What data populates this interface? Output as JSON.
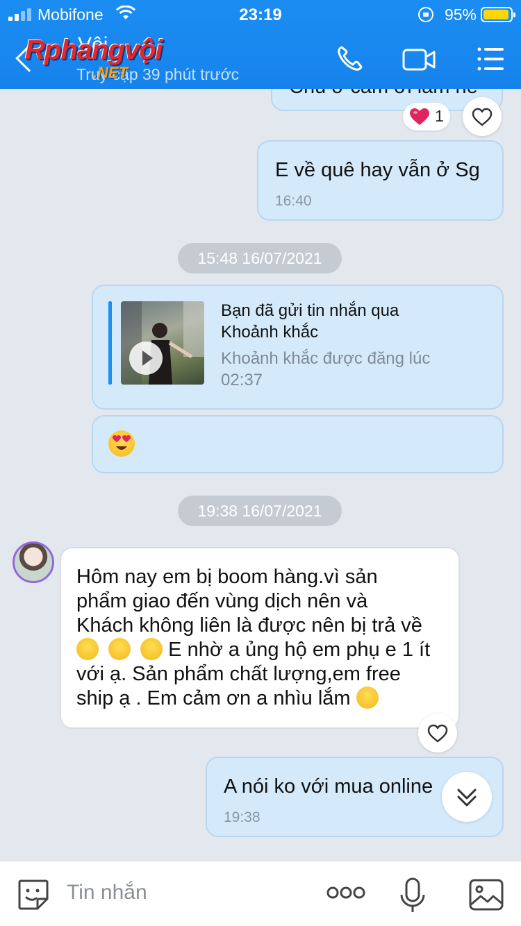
{
  "status_bar": {
    "carrier": "Mobifone",
    "time": "23:19",
    "battery": "95%",
    "battery_level": 0.95
  },
  "header": {
    "contact_name": "Vội",
    "subtitle": "Truy cập 39 phút trước",
    "watermark": "Rphangvội",
    "watermark_suffix": ".NET"
  },
  "messages": {
    "partial_text": "Chủ ơ cảm ơi lắm ne",
    "reaction_count": "1",
    "out_1": {
      "text": "E về quê hay vẫn ở Sg",
      "time": "16:40"
    },
    "separator_1": "15:48 16/07/2021",
    "quote": {
      "title_line1": "Bạn đã gửi tin nhắn qua",
      "title_line2": "Khoảnh khắc",
      "sub_line1": "Khoảnh khắc được đăng lúc",
      "sub_line2": "02:37"
    },
    "separator_2": "19:38 16/07/2021",
    "in_1": {
      "line1": "Hôm nay em bị boom hàng.vì sản",
      "line2": "phẩm giao đến vùng dịch nên và",
      "line3": "Khách không liên là được nên bị trả về",
      "line4": " E nhờ a ủng hộ em phụ e 1 ít",
      "line5": "với ạ. Sản phẩm chất lượng,em free",
      "line6": "ship ạ . Em cảm ơn a nhìu lắm "
    },
    "out_2": {
      "text": "A nói ko với mua online",
      "time": "19:38"
    }
  },
  "composer": {
    "placeholder": "Tin nhắn"
  },
  "colors": {
    "header_blue": "#1b8df2",
    "outgoing_bubble": "#d4eafb",
    "incoming_bubble": "#ffffff",
    "chat_background": "#e3e8ef"
  },
  "icons": [
    "phone-icon",
    "video-icon",
    "menu-icon",
    "back-icon",
    "heart-icon",
    "scroll-down-icon",
    "sticker-icon",
    "more-icon",
    "mic-icon",
    "image-icon"
  ]
}
